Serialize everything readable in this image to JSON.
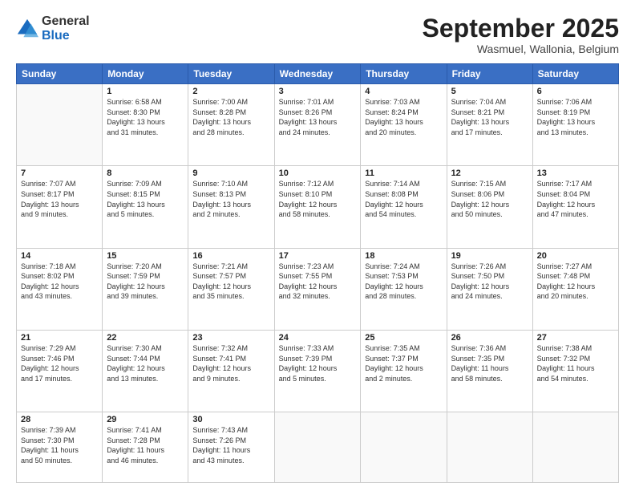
{
  "logo": {
    "general": "General",
    "blue": "Blue"
  },
  "header": {
    "month": "September 2025",
    "location": "Wasmuel, Wallonia, Belgium"
  },
  "weekdays": [
    "Sunday",
    "Monday",
    "Tuesday",
    "Wednesday",
    "Thursday",
    "Friday",
    "Saturday"
  ],
  "weeks": [
    [
      {
        "day": "",
        "info": ""
      },
      {
        "day": "1",
        "info": "Sunrise: 6:58 AM\nSunset: 8:30 PM\nDaylight: 13 hours\nand 31 minutes."
      },
      {
        "day": "2",
        "info": "Sunrise: 7:00 AM\nSunset: 8:28 PM\nDaylight: 13 hours\nand 28 minutes."
      },
      {
        "day": "3",
        "info": "Sunrise: 7:01 AM\nSunset: 8:26 PM\nDaylight: 13 hours\nand 24 minutes."
      },
      {
        "day": "4",
        "info": "Sunrise: 7:03 AM\nSunset: 8:24 PM\nDaylight: 13 hours\nand 20 minutes."
      },
      {
        "day": "5",
        "info": "Sunrise: 7:04 AM\nSunset: 8:21 PM\nDaylight: 13 hours\nand 17 minutes."
      },
      {
        "day": "6",
        "info": "Sunrise: 7:06 AM\nSunset: 8:19 PM\nDaylight: 13 hours\nand 13 minutes."
      }
    ],
    [
      {
        "day": "7",
        "info": "Sunrise: 7:07 AM\nSunset: 8:17 PM\nDaylight: 13 hours\nand 9 minutes."
      },
      {
        "day": "8",
        "info": "Sunrise: 7:09 AM\nSunset: 8:15 PM\nDaylight: 13 hours\nand 5 minutes."
      },
      {
        "day": "9",
        "info": "Sunrise: 7:10 AM\nSunset: 8:13 PM\nDaylight: 13 hours\nand 2 minutes."
      },
      {
        "day": "10",
        "info": "Sunrise: 7:12 AM\nSunset: 8:10 PM\nDaylight: 12 hours\nand 58 minutes."
      },
      {
        "day": "11",
        "info": "Sunrise: 7:14 AM\nSunset: 8:08 PM\nDaylight: 12 hours\nand 54 minutes."
      },
      {
        "day": "12",
        "info": "Sunrise: 7:15 AM\nSunset: 8:06 PM\nDaylight: 12 hours\nand 50 minutes."
      },
      {
        "day": "13",
        "info": "Sunrise: 7:17 AM\nSunset: 8:04 PM\nDaylight: 12 hours\nand 47 minutes."
      }
    ],
    [
      {
        "day": "14",
        "info": "Sunrise: 7:18 AM\nSunset: 8:02 PM\nDaylight: 12 hours\nand 43 minutes."
      },
      {
        "day": "15",
        "info": "Sunrise: 7:20 AM\nSunset: 7:59 PM\nDaylight: 12 hours\nand 39 minutes."
      },
      {
        "day": "16",
        "info": "Sunrise: 7:21 AM\nSunset: 7:57 PM\nDaylight: 12 hours\nand 35 minutes."
      },
      {
        "day": "17",
        "info": "Sunrise: 7:23 AM\nSunset: 7:55 PM\nDaylight: 12 hours\nand 32 minutes."
      },
      {
        "day": "18",
        "info": "Sunrise: 7:24 AM\nSunset: 7:53 PM\nDaylight: 12 hours\nand 28 minutes."
      },
      {
        "day": "19",
        "info": "Sunrise: 7:26 AM\nSunset: 7:50 PM\nDaylight: 12 hours\nand 24 minutes."
      },
      {
        "day": "20",
        "info": "Sunrise: 7:27 AM\nSunset: 7:48 PM\nDaylight: 12 hours\nand 20 minutes."
      }
    ],
    [
      {
        "day": "21",
        "info": "Sunrise: 7:29 AM\nSunset: 7:46 PM\nDaylight: 12 hours\nand 17 minutes."
      },
      {
        "day": "22",
        "info": "Sunrise: 7:30 AM\nSunset: 7:44 PM\nDaylight: 12 hours\nand 13 minutes."
      },
      {
        "day": "23",
        "info": "Sunrise: 7:32 AM\nSunset: 7:41 PM\nDaylight: 12 hours\nand 9 minutes."
      },
      {
        "day": "24",
        "info": "Sunrise: 7:33 AM\nSunset: 7:39 PM\nDaylight: 12 hours\nand 5 minutes."
      },
      {
        "day": "25",
        "info": "Sunrise: 7:35 AM\nSunset: 7:37 PM\nDaylight: 12 hours\nand 2 minutes."
      },
      {
        "day": "26",
        "info": "Sunrise: 7:36 AM\nSunset: 7:35 PM\nDaylight: 11 hours\nand 58 minutes."
      },
      {
        "day": "27",
        "info": "Sunrise: 7:38 AM\nSunset: 7:32 PM\nDaylight: 11 hours\nand 54 minutes."
      }
    ],
    [
      {
        "day": "28",
        "info": "Sunrise: 7:39 AM\nSunset: 7:30 PM\nDaylight: 11 hours\nand 50 minutes."
      },
      {
        "day": "29",
        "info": "Sunrise: 7:41 AM\nSunset: 7:28 PM\nDaylight: 11 hours\nand 46 minutes."
      },
      {
        "day": "30",
        "info": "Sunrise: 7:43 AM\nSunset: 7:26 PM\nDaylight: 11 hours\nand 43 minutes."
      },
      {
        "day": "",
        "info": ""
      },
      {
        "day": "",
        "info": ""
      },
      {
        "day": "",
        "info": ""
      },
      {
        "day": "",
        "info": ""
      }
    ]
  ]
}
